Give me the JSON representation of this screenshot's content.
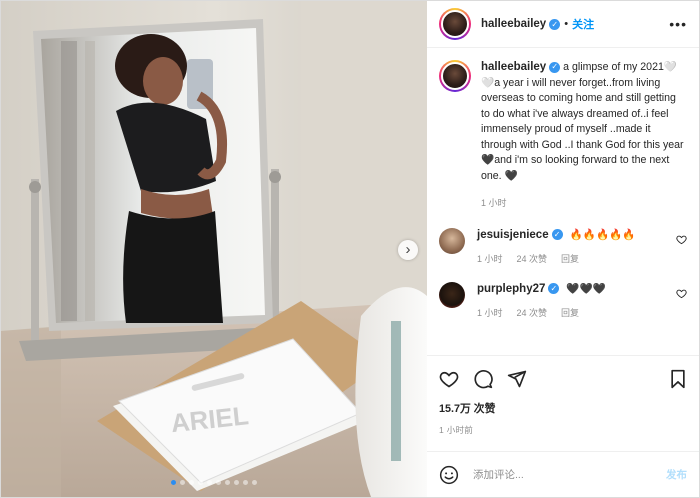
{
  "post": {
    "username": "halleebailey",
    "separator": "•",
    "follow_label": "关注",
    "more_label": "•••"
  },
  "media": {
    "photo_overlay_text": "ARIEL",
    "next_label": "›",
    "total_slides": 10,
    "active_slide": 1
  },
  "caption": {
    "username": "halleebailey",
    "text": " a glimpse of my 2021🤍🤍a year i will never forget..from living overseas to coming home and still getting to do what i've always dreamed of..i feel immensely proud of myself ..made it through with God ..I thank God for this year 🖤and i'm so looking forward to the next one. 🖤",
    "time": "1 小时"
  },
  "comments": [
    {
      "username": "jesuisjeniece",
      "text": "🔥🔥🔥🔥🔥",
      "time": "1 小时",
      "likes": "24 次赞",
      "reply": "回复"
    },
    {
      "username": "purplephy27",
      "text": "🖤🖤🖤",
      "time": "1 小时",
      "likes": "24 次赞",
      "reply": "回复"
    }
  ],
  "actions": {
    "likes": "15.7万 次赞",
    "time_ago": "1 小时前"
  },
  "composer": {
    "placeholder": "添加评论...",
    "post_label": "发布"
  },
  "colors": {
    "link_blue": "#0095f6",
    "verified_blue": "#3897f0",
    "post_disabled": "#b2dffc",
    "muted_text": "#8e8e8e"
  }
}
